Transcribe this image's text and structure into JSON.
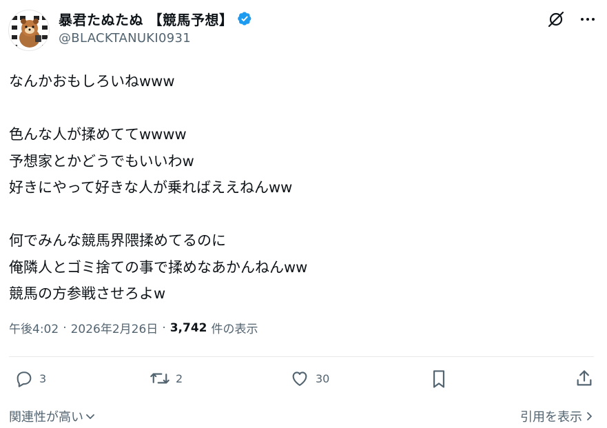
{
  "user": {
    "display_name": "暴君たぬたぬ 【競馬予想】",
    "handle": "@BLACKTANUKI0931",
    "verified": true,
    "verified_color": "#1d9bf0"
  },
  "tweet": {
    "lines_block1": [
      "なんかおもしろいねwww"
    ],
    "lines_block2": [
      "色んな人が揉めててwwww",
      "予想家とかどうでもいいわw",
      "好きにやって好きな人が乗ればええねんww"
    ],
    "lines_block3": [
      "何でみんな競馬界隈揉めてるのに",
      "俺隣人とゴミ捨ての事で揉めなあかんねんww",
      "競馬の方参戦させろよw"
    ]
  },
  "meta": {
    "time": "午後4:02",
    "separator": "·",
    "date": "2026年2月26日",
    "views_count": "3,742",
    "views_label": "件の表示"
  },
  "actions": {
    "reply_count": "3",
    "retweet_count": "2",
    "like_count": "30"
  },
  "footer": {
    "sort_label": "関連性が高い",
    "quotes_label": "引用を表示"
  },
  "icons": {
    "top": [
      "grok-icon",
      "more-icon"
    ],
    "actions": [
      "reply-icon",
      "retweet-icon",
      "like-icon",
      "bookmark-icon",
      "share-icon"
    ]
  }
}
